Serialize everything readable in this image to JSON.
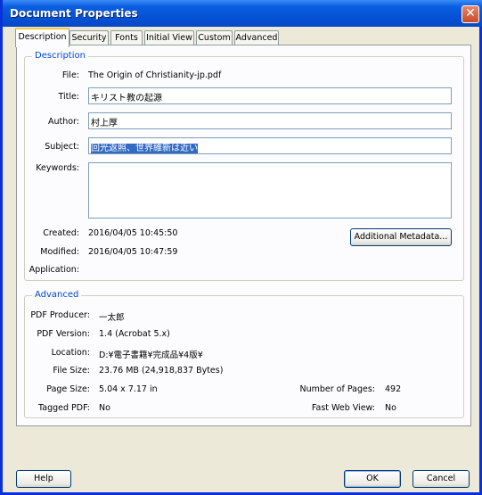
{
  "window": {
    "title": "Document Properties",
    "close_glyph": "✕"
  },
  "tabs": [
    {
      "label": "Description",
      "active": true
    },
    {
      "label": "Security"
    },
    {
      "label": "Fonts"
    },
    {
      "label": "Initial View"
    },
    {
      "label": "Custom"
    },
    {
      "label": "Advanced"
    }
  ],
  "description": {
    "group_label": "Description",
    "file_label": "File:",
    "file_value": "The Origin of Christianity-jp.pdf",
    "title_label": "Title:",
    "title_value": "キリスト教の起源",
    "author_label": "Author:",
    "author_value": "村上厚",
    "subject_label": "Subject:",
    "subject_value": "回光返照、世界維新は近い",
    "keywords_label": "Keywords:",
    "keywords_value": "",
    "created_label": "Created:",
    "created_value": "2016/04/05 10:45:50",
    "modified_label": "Modified:",
    "modified_value": "2016/04/05 10:47:59",
    "application_label": "Application:",
    "application_value": "",
    "metadata_button": "Additional Metadata..."
  },
  "advanced": {
    "group_label": "Advanced",
    "producer_label": "PDF Producer:",
    "producer_value": "一太郎",
    "version_label": "PDF Version:",
    "version_value": "1.4 (Acrobat 5.x)",
    "location_label": "Location:",
    "location_value": "D:¥電子書籍¥完成品¥4版¥",
    "filesize_label": "File Size:",
    "filesize_value": "23.76 MB (24,918,837 Bytes)",
    "pagesize_label": "Page Size:",
    "pagesize_value": "5.04 x 7.17 in",
    "pages_label": "Number of Pages:",
    "pages_value": "492",
    "tagged_label": "Tagged PDF:",
    "tagged_value": "No",
    "fastweb_label": "Fast Web View:",
    "fastweb_value": "No"
  },
  "buttons": {
    "help": "Help",
    "ok": "OK",
    "cancel": "Cancel"
  }
}
